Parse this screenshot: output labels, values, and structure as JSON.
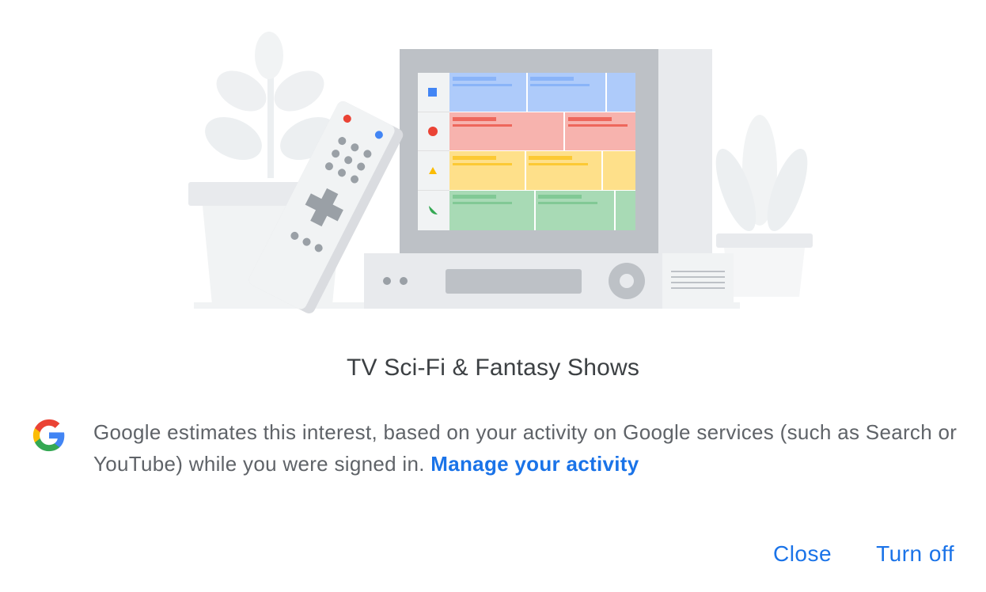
{
  "dialog": {
    "title": "TV Sci-Fi & Fantasy Shows",
    "info": {
      "description": "Google estimates this interest, based on your activity on Google services (such as Search or YouTube) while you were signed in.",
      "link_label": "Manage your activity"
    },
    "actions": {
      "close_label": "Close",
      "turn_off_label": "Turn off"
    }
  },
  "colors": {
    "accent": "#1a73e8",
    "title_text": "#3c4043",
    "body_text": "#5f6368",
    "guide_blue": "#aecbfa",
    "guide_red": "#f28b82",
    "guide_yellow": "#fdd663",
    "guide_green": "#a8dab5"
  },
  "icons": [
    "google-g-icon",
    "tv-illustration",
    "remote-control-illustration",
    "plant-illustration"
  ]
}
